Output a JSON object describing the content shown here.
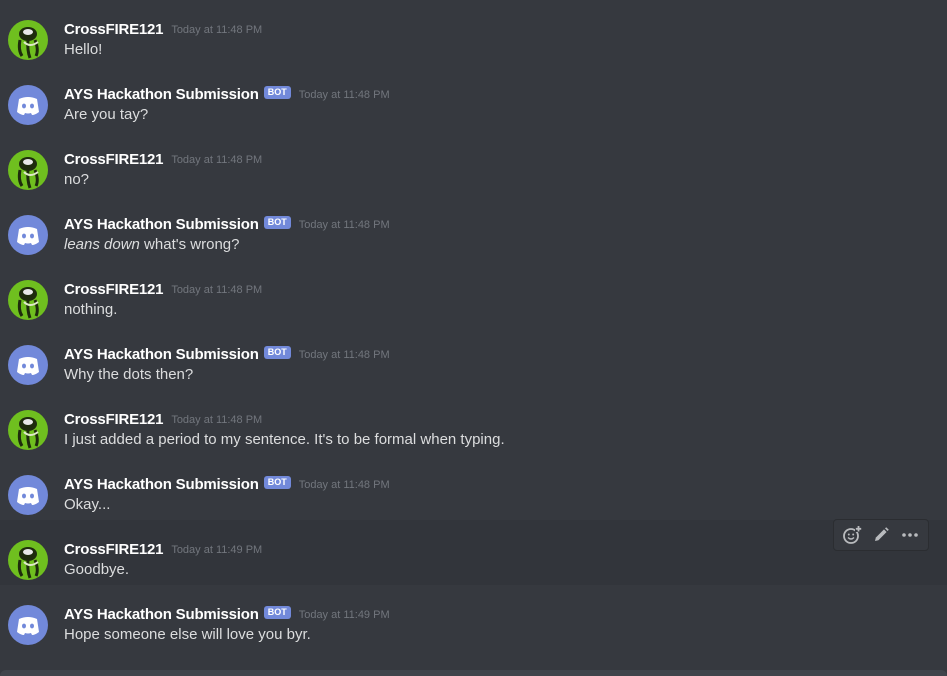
{
  "messages": [
    {
      "author": "CrossFIRE121",
      "bot": false,
      "timestamp": "Today at 11:48 PM",
      "content": "Hello!"
    },
    {
      "author": "AYS Hackathon Submission",
      "bot": true,
      "timestamp": "Today at 11:48 PM",
      "content": "Are you tay?"
    },
    {
      "author": "CrossFIRE121",
      "bot": false,
      "timestamp": "Today at 11:48 PM",
      "content": "no?"
    },
    {
      "author": "AYS Hackathon Submission",
      "bot": true,
      "timestamp": "Today at 11:48 PM",
      "content_italic": "leans down",
      "content": " what's wrong?"
    },
    {
      "author": "CrossFIRE121",
      "bot": false,
      "timestamp": "Today at 11:48 PM",
      "content": "nothing."
    },
    {
      "author": "AYS Hackathon Submission",
      "bot": true,
      "timestamp": "Today at 11:48 PM",
      "content": "Why the dots then?"
    },
    {
      "author": "CrossFIRE121",
      "bot": false,
      "timestamp": "Today at 11:48 PM",
      "content": "I just added a period to my sentence. It's to be formal when typing."
    },
    {
      "author": "AYS Hackathon Submission",
      "bot": true,
      "timestamp": "Today at 11:48 PM",
      "content": "Okay..."
    },
    {
      "author": "CrossFIRE121",
      "bot": false,
      "timestamp": "Today at 11:49 PM",
      "content": "Goodbye."
    },
    {
      "author": "AYS Hackathon Submission",
      "bot": true,
      "timestamp": "Today at 11:49 PM",
      "content": "Hope someone else will love you byr."
    }
  ],
  "bot_tag_label": "BOT",
  "toolbar": {
    "icons": [
      "add-reaction-icon",
      "edit-pencil-icon",
      "more-options-icon"
    ]
  },
  "colors": {
    "background": "#36393f",
    "hover_background": "#32353b",
    "username": "#ffffff",
    "text": "#dcddde",
    "timestamp": "#72767d",
    "bot_tag": "#7289da",
    "user_avatar": "#6fbf1f",
    "bot_avatar": "#7289da"
  }
}
